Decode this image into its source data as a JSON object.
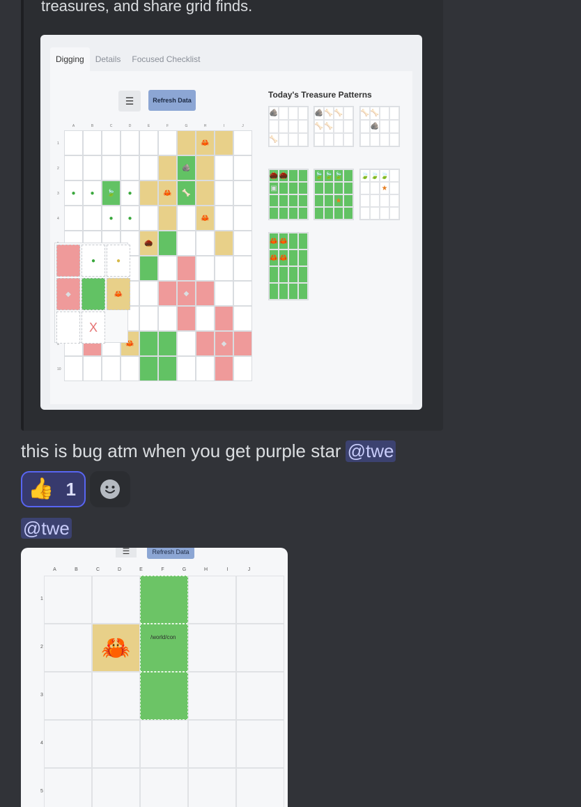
{
  "embed": {
    "description": "treasures, and share grid finds.",
    "tabs": [
      "Digging",
      "Details",
      "Focused Checklist"
    ],
    "menu_icon": "☰",
    "refresh_label": "Refresh Data",
    "patterns_title": "Today's Treasure Patterns",
    "col_labels": [
      "A",
      "B",
      "C",
      "D",
      "E",
      "F",
      "G",
      "H",
      "I",
      "J"
    ],
    "row_labels": [
      "1",
      "2",
      "3",
      "4",
      "5",
      "6",
      "7",
      "8",
      "9",
      "10"
    ],
    "popup_x": "X"
  },
  "message": {
    "text": "this is bug atm when you get purple star",
    "mention": "@twe"
  },
  "reactions": [
    {
      "emoji": "👍",
      "count": "1"
    }
  ],
  "mention_line": "@twe",
  "attachment": {
    "menu_icon": "☰",
    "refresh_label": "Refresh Data",
    "col_labels": [
      "A",
      "B",
      "C",
      "D",
      "E",
      "F",
      "G",
      "H",
      "I",
      "J"
    ],
    "row_labels": [
      "1",
      "2",
      "3",
      "4",
      "5"
    ],
    "broken_image_alt": "/world/con"
  },
  "colors": {
    "background": "#313338",
    "mention_bg": "#3c4270",
    "reaction_border": "#5865f2"
  }
}
